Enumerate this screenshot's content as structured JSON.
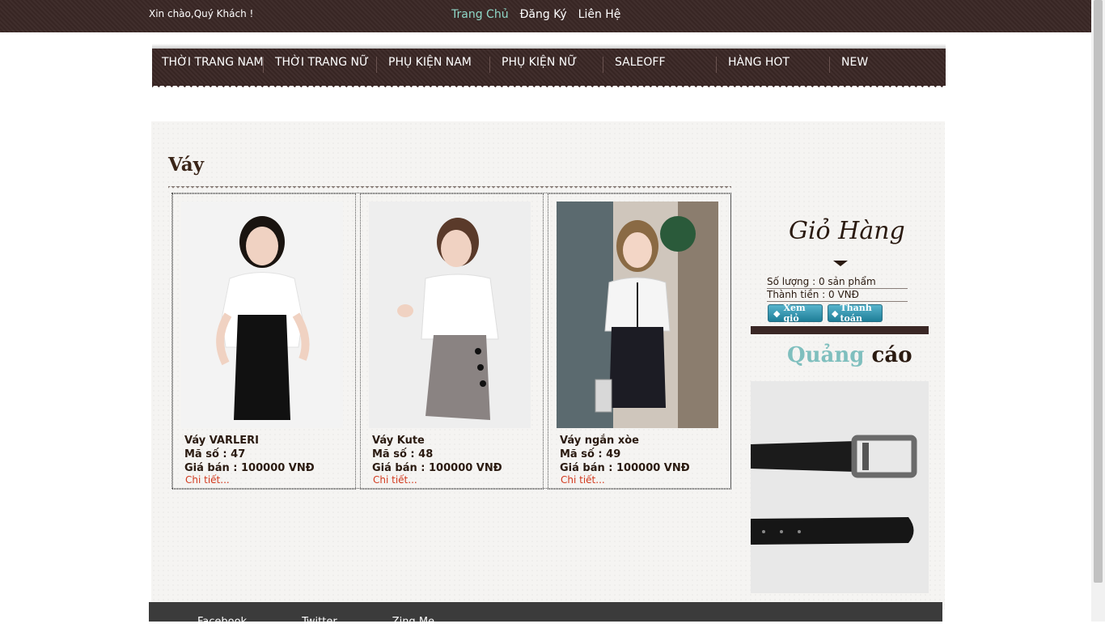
{
  "header": {
    "greeting": "Xin chào,Quý Khách !",
    "links": [
      "Trang Chủ",
      "Đăng Ký",
      "Liên Hệ"
    ]
  },
  "nav": {
    "items": [
      "THỜI TRANG NAM",
      "THỜI TRANG NỮ",
      "PHỤ KIỆN NAM",
      "PHỤ KIỆN NỮ",
      "SALEOFF",
      "HÀNG HOT",
      "NEW"
    ]
  },
  "section": {
    "title": "Váy"
  },
  "products": [
    {
      "name": "Váy VARLERI",
      "code": "Mã số : 47",
      "price": "Giá bán : 100000 VNĐ",
      "detail": "Chi tiết..."
    },
    {
      "name": "Váy Kute",
      "code": "Mã số : 48",
      "price": "Giá bán : 100000 VNĐ",
      "detail": "Chi tiết..."
    },
    {
      "name": "Váy ngắn xòe",
      "code": "Mã số : 49",
      "price": "Giá bán : 100000 VNĐ",
      "detail": "Chi tiết..."
    }
  ],
  "cart": {
    "title": "Giỏ Hàng",
    "quantity": "Số lượng : 0 sản phẩm",
    "total": "Thành tiền : 0 VNĐ",
    "view_button": "Xem giỏ",
    "checkout_button": "Thanh toán"
  },
  "ads": {
    "title_part1": "Quảng",
    "title_part2": "cáo"
  },
  "footer": {
    "links": [
      "Facebook",
      "Twitter",
      "Zing Me"
    ]
  },
  "colors": {
    "brand_dark": "#3a2725",
    "accent_teal": "#8fd8c8",
    "link_red": "#d23a1e"
  }
}
